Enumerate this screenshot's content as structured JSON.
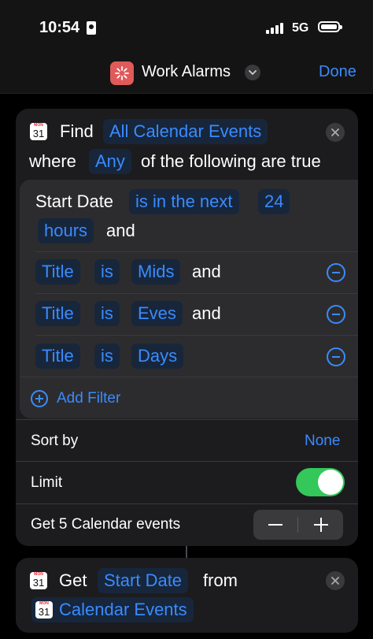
{
  "status_bar": {
    "time": "10:54",
    "network": "5G"
  },
  "nav": {
    "title": "Work Alarms",
    "done_label": "Done"
  },
  "find_action": {
    "icon": {
      "month": "MON",
      "day": "31"
    },
    "find_label": "Find",
    "source_token": "All Calendar Events",
    "where_label": "where",
    "mode_token": "Any",
    "condition_text": "of the following are true",
    "filters": [
      {
        "field": "Start Date",
        "operator": "is in the next",
        "value": "24",
        "unit": "hours",
        "joiner": "and"
      },
      {
        "field": "Title",
        "operator": "is",
        "value": "Mids",
        "joiner": "and"
      },
      {
        "field": "Title",
        "operator": "is",
        "value": "Eves",
        "joiner": "and"
      },
      {
        "field": "Title",
        "operator": "is",
        "value": "Days"
      }
    ],
    "add_filter_label": "Add Filter",
    "sort_by": {
      "label": "Sort by",
      "value": "None"
    },
    "limit": {
      "label": "Limit",
      "enabled": true,
      "color": "#34c759"
    },
    "count_label": "Get 5 Calendar events"
  },
  "get_action": {
    "icon": {
      "month": "MON",
      "day": "31"
    },
    "get_label": "Get",
    "property_token": "Start Date",
    "from_label": "from",
    "source_token": "Calendar Events"
  },
  "colors": {
    "accent": "#3a8bff",
    "card": "#1c1c1e",
    "toggle_on": "#34c759",
    "app_icon": "#e05a5a"
  }
}
